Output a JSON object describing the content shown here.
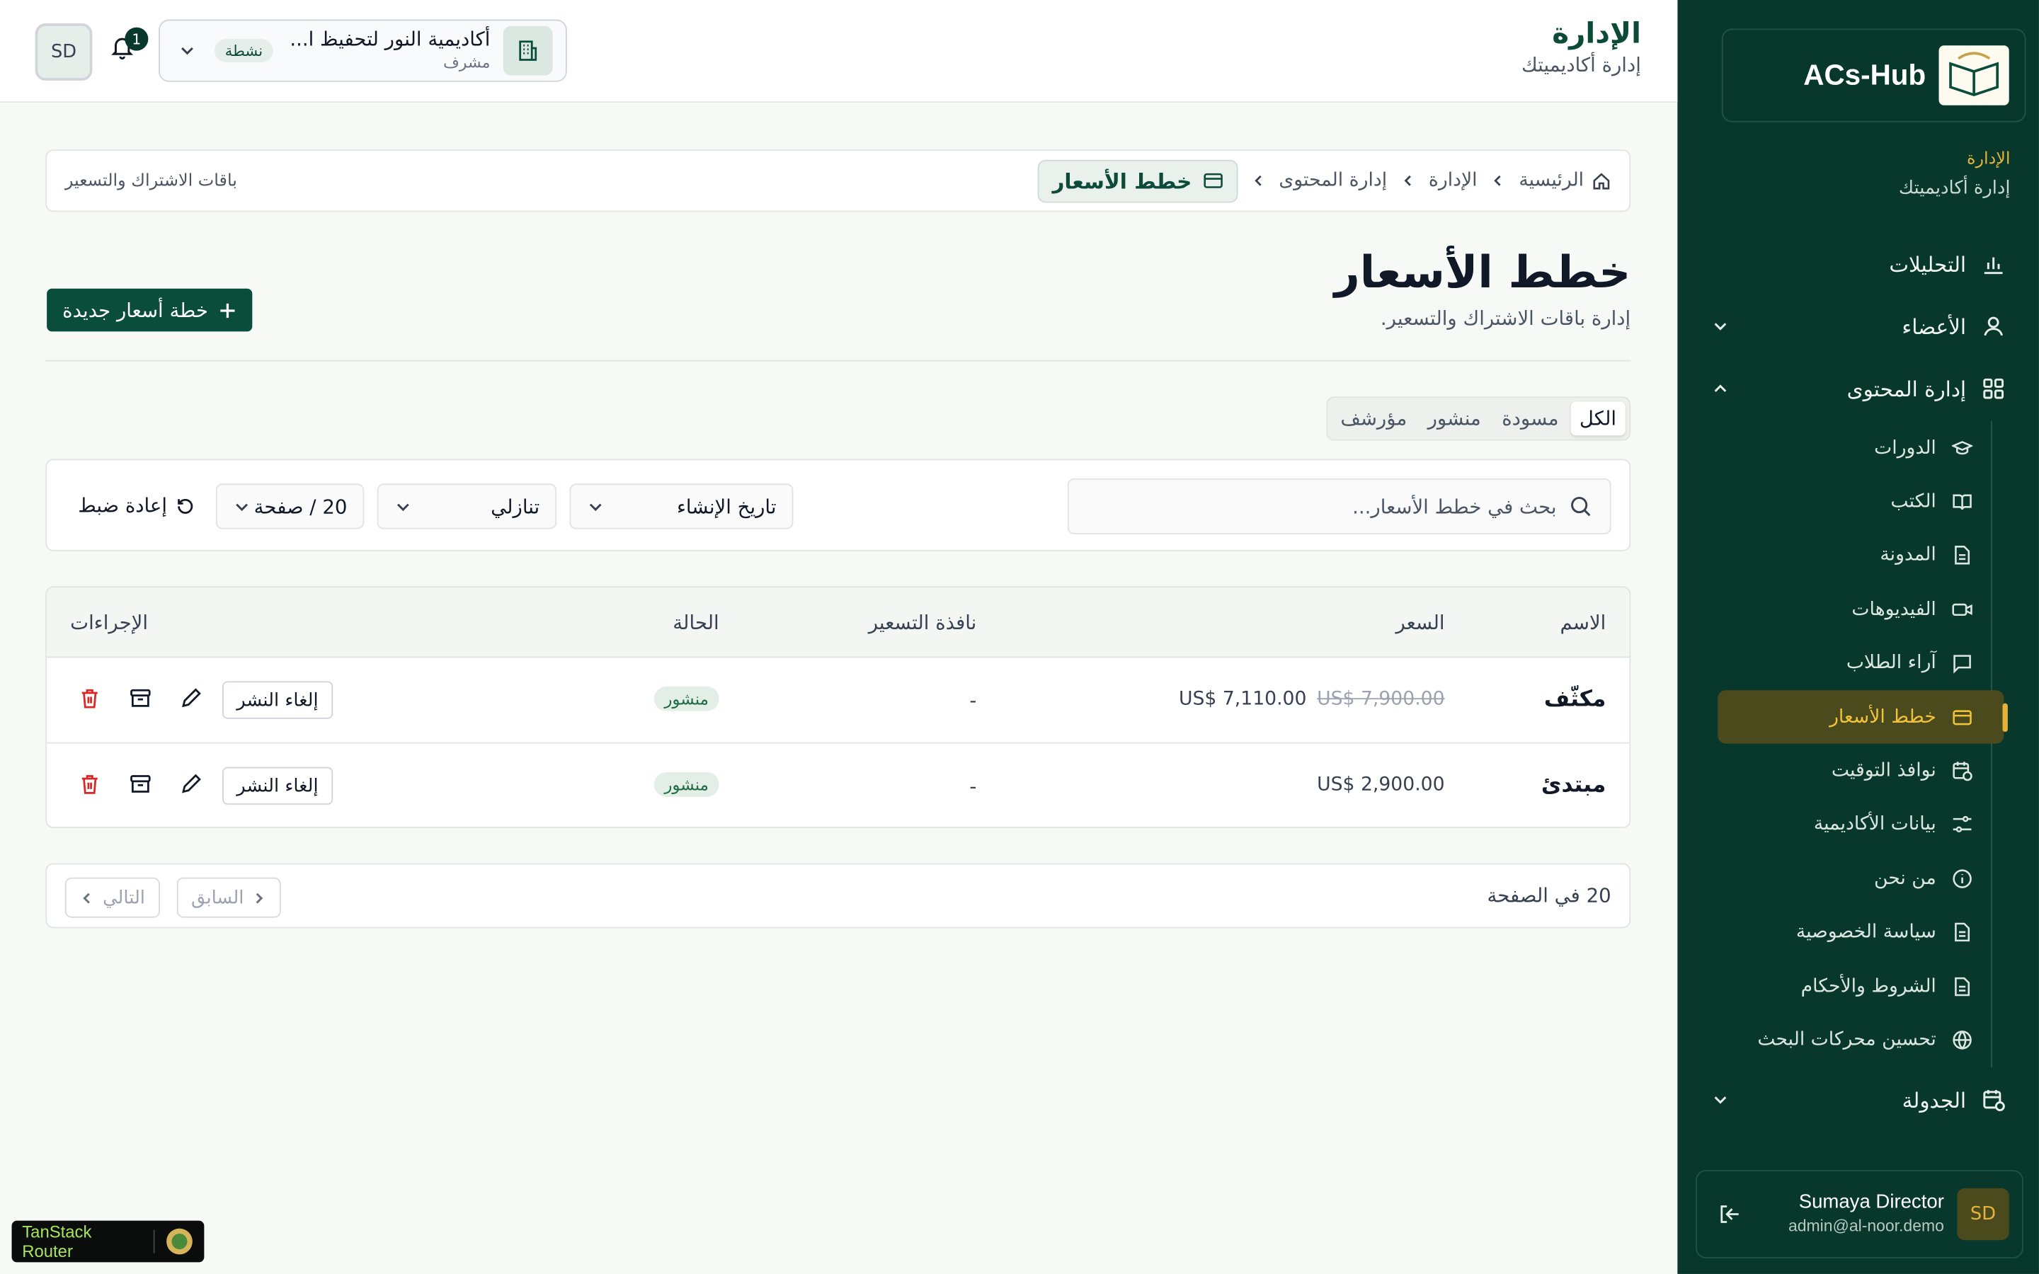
{
  "sidebar": {
    "brand": "ACs-Hub",
    "section_label": "الإدارة",
    "section_sub": "إدارة أكاديميتك",
    "nav": [
      {
        "label": "التحليلات",
        "icon": "chart-icon"
      },
      {
        "label": "الأعضاء",
        "icon": "user-icon"
      },
      {
        "label": "إدارة المحتوى",
        "icon": "grid-icon"
      }
    ],
    "sub_items": [
      {
        "label": "الدورات",
        "icon": "graduation-cap-icon"
      },
      {
        "label": "الكتب",
        "icon": "book-icon"
      },
      {
        "label": "المدونة",
        "icon": "document-icon"
      },
      {
        "label": "الفيديوهات",
        "icon": "video-icon"
      },
      {
        "label": "آراء الطلاب",
        "icon": "message-icon"
      },
      {
        "label": "خطط الأسعار",
        "icon": "credit-card-icon"
      },
      {
        "label": "نوافذ التوقيت",
        "icon": "calendar-clock-icon"
      },
      {
        "label": "بيانات الأكاديمية",
        "icon": "sliders-icon"
      },
      {
        "label": "من نحن",
        "icon": "info-icon"
      },
      {
        "label": "سياسة الخصوصية",
        "icon": "document-icon"
      },
      {
        "label": "الشروط والأحكام",
        "icon": "document-icon"
      },
      {
        "label": "تحسين محركات البحث",
        "icon": "globe-icon"
      }
    ],
    "schedule": "الجدولة",
    "user": {
      "initials": "SD",
      "name": "Sumaya Director",
      "email": "admin@al-noor.demo"
    }
  },
  "header": {
    "title": "الإدارة",
    "subtitle": "إدارة أكاديميتك",
    "academy": {
      "name": "أكاديمية النور لتحفيظ ا...",
      "role": "مشرف",
      "status": "نشطة"
    },
    "notifications": "1",
    "avatar": "SD"
  },
  "breadcrumb": {
    "items": [
      "الرئيسية",
      "الإدارة",
      "إدارة المحتوى"
    ],
    "current": "خطط الأسعار",
    "right_text": "باقات الاشتراك والتسعير"
  },
  "page": {
    "title": "خطط الأسعار",
    "subtitle": "إدارة باقات الاشتراك والتسعير.",
    "new_button": "خطة أسعار جديدة"
  },
  "tabs": [
    "الكل",
    "مسودة",
    "منشور",
    "مؤرشف"
  ],
  "filters": {
    "search_placeholder": "بحث في خطط الأسعار...",
    "sort_by": "تاريخ الإنشاء",
    "order": "تنازلي",
    "per_page": "20 / صفحة",
    "reset": "إعادة ضبط"
  },
  "table": {
    "columns": [
      "الاسم",
      "السعر",
      "نافذة التسعير",
      "الحالة",
      "الإجراءات"
    ],
    "rows": [
      {
        "name": "مكثّف",
        "price_old": "US$ 7,900.00",
        "price": "US$ 7,110.00",
        "window": "-",
        "status": "منشور",
        "action": "إلغاء النشر"
      },
      {
        "name": "مبتدئ",
        "price_old": "",
        "price": "US$ 2,900.00",
        "window": "-",
        "status": "منشور",
        "action": "إلغاء النشر"
      }
    ]
  },
  "pagination": {
    "per_page": "20 في الصفحة",
    "prev": "السابق",
    "next": "التالي"
  },
  "devtools": {
    "label": "TanStack Router"
  },
  "colors": {
    "sidebar": "#08372c",
    "accent": "#e5b23a",
    "primary": "#0a4d3b",
    "danger": "#dc2626"
  }
}
